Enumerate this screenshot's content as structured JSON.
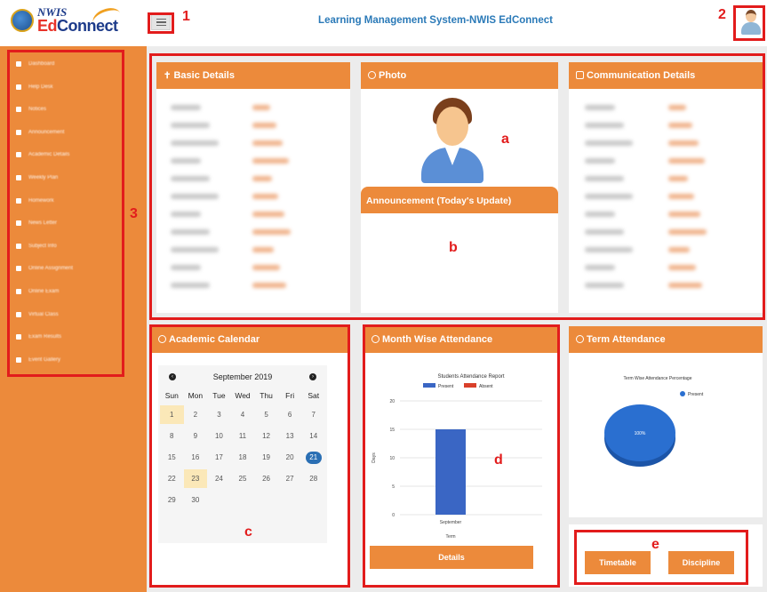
{
  "header": {
    "logo_top": "NWIS",
    "logo_bottom_a": "Ed",
    "logo_bottom_b": "Connect",
    "title": "Learning Management System-NWIS EdConnect"
  },
  "sidebar": {
    "items": [
      {
        "label": "Dashboard",
        "icon": "grid-icon"
      },
      {
        "label": "Help Desk",
        "icon": "help-icon"
      },
      {
        "label": "Notices",
        "icon": "bell-icon"
      },
      {
        "label": "Announcement",
        "icon": "megaphone-icon"
      },
      {
        "label": "Academic Details",
        "icon": "book-icon"
      },
      {
        "label": "Weekly Plan",
        "icon": "calendar-icon"
      },
      {
        "label": "Homework",
        "icon": "file-icon"
      },
      {
        "label": "News Letter",
        "icon": "newspaper-icon"
      },
      {
        "label": "Subject Info",
        "icon": "list-icon"
      },
      {
        "label": "Online Assignment",
        "icon": "document-icon"
      },
      {
        "label": "Online Exam",
        "icon": "exam-icon"
      },
      {
        "label": "Virtual Class",
        "icon": "video-icon"
      },
      {
        "label": "Exam Results",
        "icon": "results-icon"
      },
      {
        "label": "Event Gallery",
        "icon": "gallery-icon"
      }
    ]
  },
  "panels": {
    "basic_details": "Basic Details",
    "photo": "Photo",
    "communication": "Communication Details",
    "announcement": "Announcement (Today's Update)",
    "calendar": "Academic Calendar",
    "month_attendance": "Month Wise Attendance",
    "term_attendance": "Term Attendance"
  },
  "calendar": {
    "month": "September 2019",
    "prev": "‹",
    "next": "›",
    "dow": [
      "Sun",
      "Mon",
      "Tue",
      "Wed",
      "Thu",
      "Fri",
      "Sat"
    ],
    "weeks": [
      [
        "1",
        "2",
        "3",
        "4",
        "5",
        "6",
        "7"
      ],
      [
        "8",
        "9",
        "10",
        "11",
        "12",
        "13",
        "14"
      ],
      [
        "15",
        "16",
        "17",
        "18",
        "19",
        "20",
        "21"
      ],
      [
        "22",
        "23",
        "24",
        "25",
        "26",
        "27",
        "28"
      ],
      [
        "29",
        "30",
        "",
        "",
        "",
        "",
        ""
      ]
    ],
    "today": "1",
    "highlight": "23",
    "selected": "21"
  },
  "chart_data": [
    {
      "type": "bar",
      "title": "Students Attendance Report",
      "categories": [
        "September"
      ],
      "series": [
        {
          "name": "Present",
          "values": [
            15
          ],
          "color": "#3a66c4"
        },
        {
          "name": "Absent",
          "values": [
            0
          ],
          "color": "#d9402a"
        }
      ],
      "xlabel": "Term",
      "ylabel": "Days",
      "ylim": [
        0,
        20
      ],
      "yticks": [
        0,
        5,
        10,
        15,
        20
      ],
      "legend": "top"
    },
    {
      "type": "pie",
      "title": "Term Wise Attendance Percentage",
      "slices": [
        {
          "name": "Present",
          "value": 100,
          "label": "100%",
          "color": "#2a6fd0"
        }
      ],
      "legend": "top-right"
    }
  ],
  "buttons": {
    "details": "Details",
    "timetable": "Timetable",
    "discipline": "Discipline"
  },
  "annotations": {
    "n1": "1",
    "n2": "2",
    "n3": "3",
    "a": "a",
    "b": "b",
    "c": "c",
    "d": "d",
    "e": "e"
  },
  "colors": {
    "accent": "#ec8a3b",
    "annotation": "#e21c1c",
    "title": "#2b7ab8"
  }
}
